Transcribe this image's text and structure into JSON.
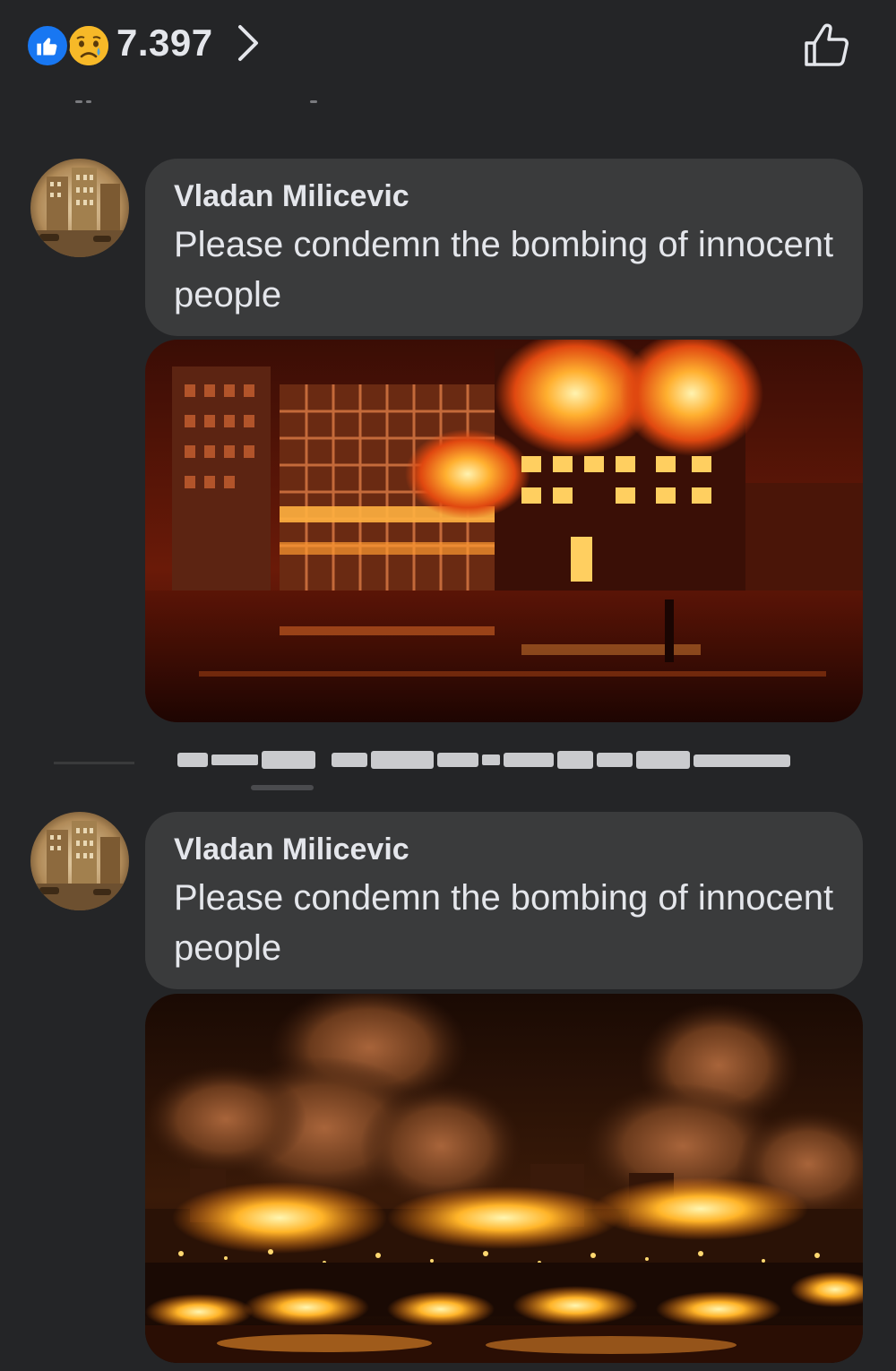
{
  "reactions": {
    "count": "7.397",
    "types": [
      "like-icon",
      "sad-face-icon"
    ],
    "like_color": "#1877f2",
    "sad_color": "#f7b928"
  },
  "comments": [
    {
      "author": "Vladan Milicevic",
      "text": "Please condemn the bombing of innocent people",
      "photo": "burning-building-night"
    },
    {
      "author": "Vladan Milicevic",
      "text": "Please condemn the bombing of innocent people",
      "photo": "city-skyline-fires-night"
    }
  ],
  "colors": {
    "background": "#242527",
    "bubble": "#3a3b3c",
    "text": "#e4e6eb"
  }
}
